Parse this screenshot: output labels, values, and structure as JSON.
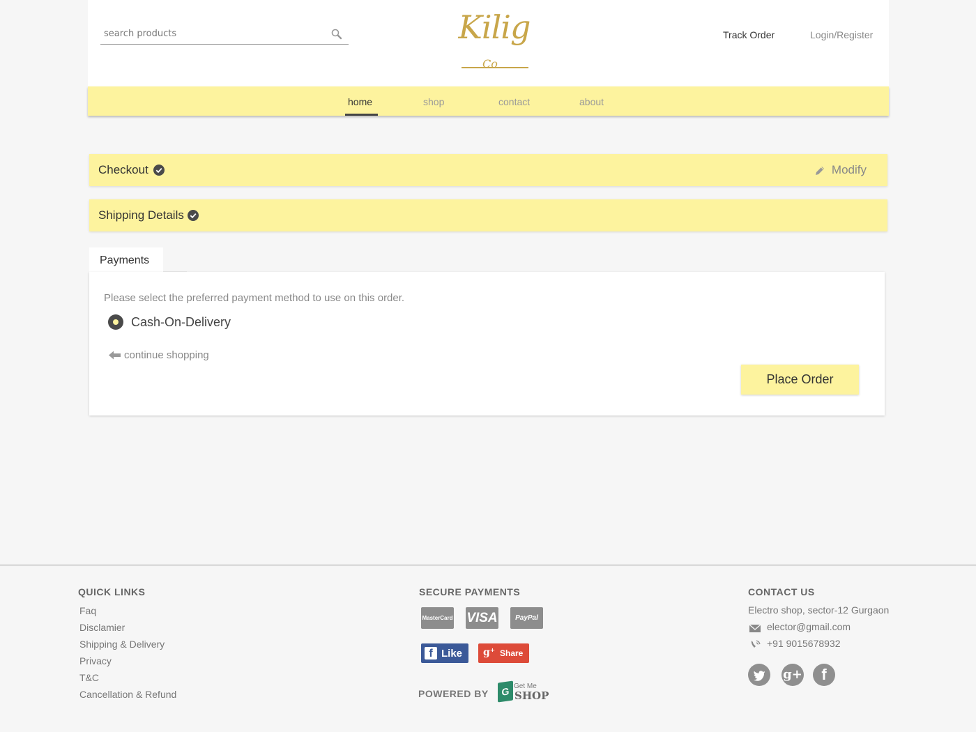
{
  "header": {
    "search_placeholder": "search products",
    "logo_text": "Kilig",
    "logo_sub": "Co",
    "track_order": "Track Order",
    "login_register": "Login/Register"
  },
  "nav": {
    "items": [
      {
        "label": "home",
        "active": true
      },
      {
        "label": "shop",
        "active": false
      },
      {
        "label": "contact",
        "active": false
      },
      {
        "label": "about",
        "active": false
      }
    ]
  },
  "checkout": {
    "checkout_title": "Checkout",
    "modify_label": "Modify",
    "shipping_title": "Shipping Details",
    "payments_tab": "Payments",
    "payment_description": "Please select the preferred payment method to use on this order.",
    "payment_option": "Cash-On-Delivery",
    "continue_shopping": "continue shopping",
    "place_order": "Place Order"
  },
  "footer": {
    "quick_links_title": "QUICK LINKS",
    "quick_links": [
      "Faq",
      "Disclamier",
      "Shipping & Delivery",
      "Privacy",
      "T&C",
      "Cancellation & Refund"
    ],
    "secure_payments_title": "SECURE PAYMENTS",
    "payment_cards": [
      "MasterCard",
      "VISA",
      "PayPal"
    ],
    "fb_like": "Like",
    "gplus_share": "Share",
    "powered_by": "POWERED BY",
    "powered_logo_top": "Get Me",
    "powered_logo_bottom": "SHOP",
    "contact_title": "CONTACT US",
    "address": "Electro shop, sector-12 Gurgaon",
    "email": "elector@gmail.com",
    "phone": "+91 9015678932",
    "social": [
      "twitter",
      "google-plus",
      "facebook"
    ]
  },
  "colors": {
    "accent_yellow": "#fdf39e",
    "logo_gold": "#c8a64a",
    "dark": "#4a4a4a"
  }
}
